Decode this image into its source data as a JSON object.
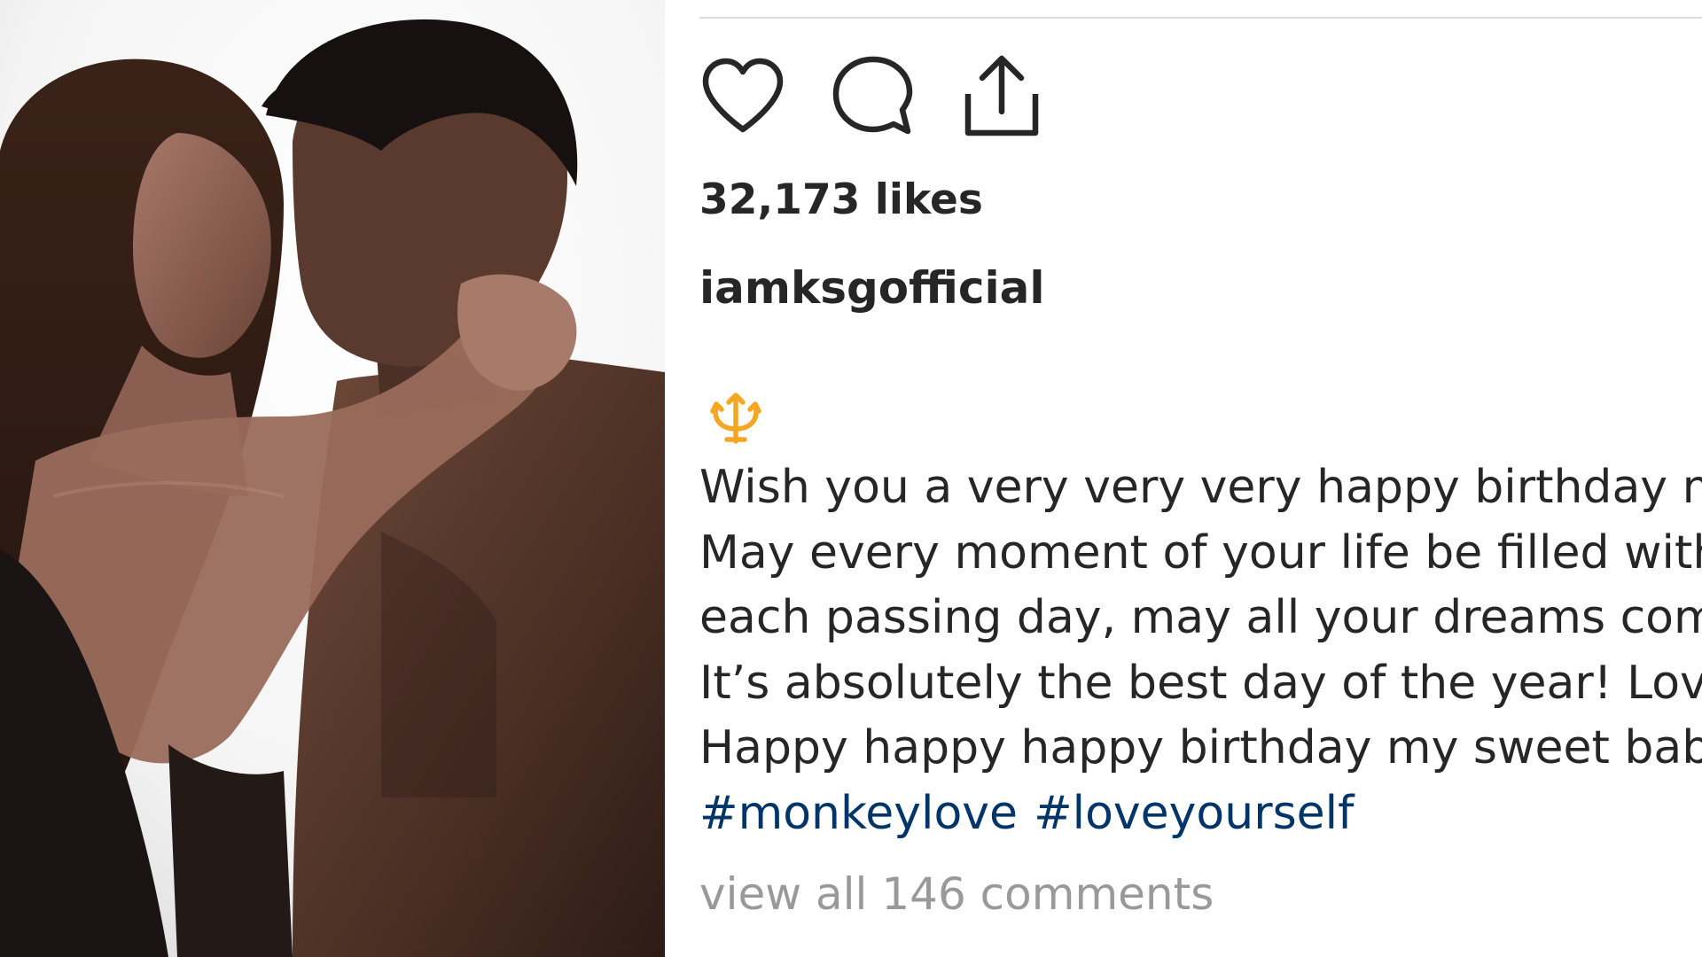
{
  "post": {
    "likes_text": "32,173 likes",
    "username": "iamksgofficial",
    "caption_lines": [
      "Wish you a very very very happy birthday my",
      "May every moment of your life be filled with",
      "each passing day, may all your dreams come",
      "It’s absolutely the best day of the year! Love y",
      "Happy happy happy birthday my sweet baby"
    ],
    "hashtags": [
      "#monkeylove",
      "#loveyourself"
    ],
    "view_comments_text": "view all 146 comments"
  },
  "icons": {
    "like": "heart-outline-icon",
    "comment": "speech-bubble-icon",
    "share": "share-upload-icon",
    "emoji": "trident-emoji-icon"
  },
  "colors": {
    "text": "#262626",
    "hashtag": "#003569",
    "muted": "#999999",
    "divider": "#dbdbdb",
    "emoji": "#f5a623"
  }
}
